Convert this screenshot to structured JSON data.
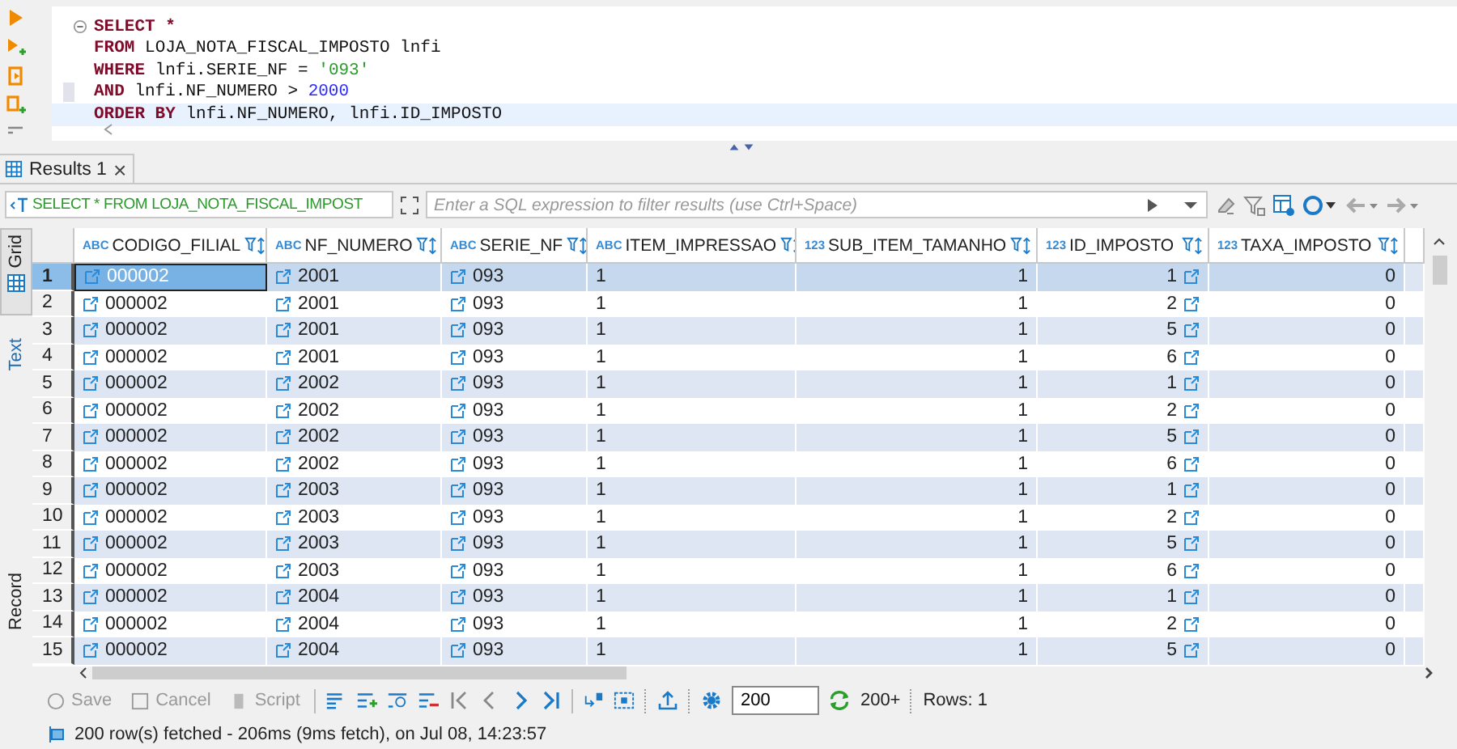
{
  "editor": {
    "lines": [
      {
        "current": false,
        "marker": false,
        "fold": true,
        "tokens": [
          {
            "kind": "keyword",
            "text": "SELECT *"
          }
        ]
      },
      {
        "current": false,
        "marker": false,
        "fold": false,
        "tokens": [
          {
            "kind": "keyword",
            "text": "FROM"
          },
          {
            "kind": "plain",
            "text": " LOJA_NOTA_FISCAL_IMPOSTO lnfi"
          }
        ]
      },
      {
        "current": false,
        "marker": false,
        "fold": false,
        "tokens": [
          {
            "kind": "keyword",
            "text": "WHERE"
          },
          {
            "kind": "plain",
            "text": " lnfi.SERIE_NF = "
          },
          {
            "kind": "string",
            "text": "'093'"
          }
        ]
      },
      {
        "current": false,
        "marker": true,
        "fold": false,
        "tokens": [
          {
            "kind": "keyword",
            "text": "AND"
          },
          {
            "kind": "plain",
            "text": " lnfi.NF_NUMERO > "
          },
          {
            "kind": "number",
            "text": "2000"
          }
        ]
      },
      {
        "current": true,
        "marker": false,
        "fold": false,
        "tokens": [
          {
            "kind": "keyword",
            "text": "ORDER BY"
          },
          {
            "kind": "plain",
            "text": " lnfi.NF_NUMERO, lnfi.ID_IMPOSTO"
          }
        ]
      }
    ]
  },
  "results_tab": {
    "label": "Results 1",
    "close": "×"
  },
  "side_tabs": [
    {
      "label": "Grid",
      "selected": true
    },
    {
      "label": "Text",
      "selected": false
    },
    {
      "label": "Record",
      "selected": false
    }
  ],
  "filter": {
    "query": "SELECT * FROM LOJA_NOTA_FISCAL_IMPOST",
    "placeholder": "Enter a SQL expression to filter results (use Ctrl+Space)"
  },
  "table": {
    "columns": [
      {
        "type": "ABC",
        "name": "CODIGO_FILIAL",
        "kind": "text",
        "link": true
      },
      {
        "type": "ABC",
        "name": "NF_NUMERO",
        "kind": "text",
        "link": true
      },
      {
        "type": "ABC",
        "name": "SERIE_NF",
        "kind": "text",
        "link": true
      },
      {
        "type": "ABC",
        "name": "ITEM_IMPRESSAO",
        "kind": "text",
        "link": false
      },
      {
        "type": "123",
        "name": "SUB_ITEM_TAMANHO",
        "kind": "number",
        "link": false
      },
      {
        "type": "123",
        "name": "ID_IMPOSTO",
        "kind": "number",
        "link": true
      },
      {
        "type": "123",
        "name": "TAXA_IMPOSTO",
        "kind": "number",
        "link": false
      }
    ],
    "rows": [
      {
        "number": "1",
        "selected": true,
        "cells": [
          "000002",
          "2001",
          "093",
          "1",
          "1",
          "1",
          "0"
        ]
      },
      {
        "number": "2",
        "selected": false,
        "cells": [
          "000002",
          "2001",
          "093",
          "1",
          "1",
          "2",
          "0"
        ]
      },
      {
        "number": "3",
        "selected": false,
        "cells": [
          "000002",
          "2001",
          "093",
          "1",
          "1",
          "5",
          "0"
        ]
      },
      {
        "number": "4",
        "selected": false,
        "cells": [
          "000002",
          "2001",
          "093",
          "1",
          "1",
          "6",
          "0"
        ]
      },
      {
        "number": "5",
        "selected": false,
        "cells": [
          "000002",
          "2002",
          "093",
          "1",
          "1",
          "1",
          "0"
        ]
      },
      {
        "number": "6",
        "selected": false,
        "cells": [
          "000002",
          "2002",
          "093",
          "1",
          "1",
          "2",
          "0"
        ]
      },
      {
        "number": "7",
        "selected": false,
        "cells": [
          "000002",
          "2002",
          "093",
          "1",
          "1",
          "5",
          "0"
        ]
      },
      {
        "number": "8",
        "selected": false,
        "cells": [
          "000002",
          "2002",
          "093",
          "1",
          "1",
          "6",
          "0"
        ]
      },
      {
        "number": "9",
        "selected": false,
        "cells": [
          "000002",
          "2003",
          "093",
          "1",
          "1",
          "1",
          "0"
        ]
      },
      {
        "number": "10",
        "selected": false,
        "cells": [
          "000002",
          "2003",
          "093",
          "1",
          "1",
          "2",
          "0"
        ]
      },
      {
        "number": "11",
        "selected": false,
        "cells": [
          "000002",
          "2003",
          "093",
          "1",
          "1",
          "5",
          "0"
        ]
      },
      {
        "number": "12",
        "selected": false,
        "cells": [
          "000002",
          "2003",
          "093",
          "1",
          "1",
          "6",
          "0"
        ]
      },
      {
        "number": "13",
        "selected": false,
        "cells": [
          "000002",
          "2004",
          "093",
          "1",
          "1",
          "1",
          "0"
        ]
      },
      {
        "number": "14",
        "selected": false,
        "cells": [
          "000002",
          "2004",
          "093",
          "1",
          "1",
          "2",
          "0"
        ]
      },
      {
        "number": "15",
        "selected": false,
        "cells": [
          "000002",
          "2004",
          "093",
          "1",
          "1",
          "5",
          "0"
        ]
      }
    ]
  },
  "bottom_toolbar": {
    "buttons": [
      {
        "label": "Save",
        "disabled": true
      },
      {
        "label": "Cancel",
        "disabled": true
      },
      {
        "label": "Script",
        "disabled": true
      }
    ],
    "fetch_size": "200",
    "fetch_more": "200+",
    "rows_label": "Rows: 1"
  },
  "status_bar": {
    "text": "200 row(s) fetched - 206ms (9ms fetch), on Jul 08, 14:23:57"
  }
}
